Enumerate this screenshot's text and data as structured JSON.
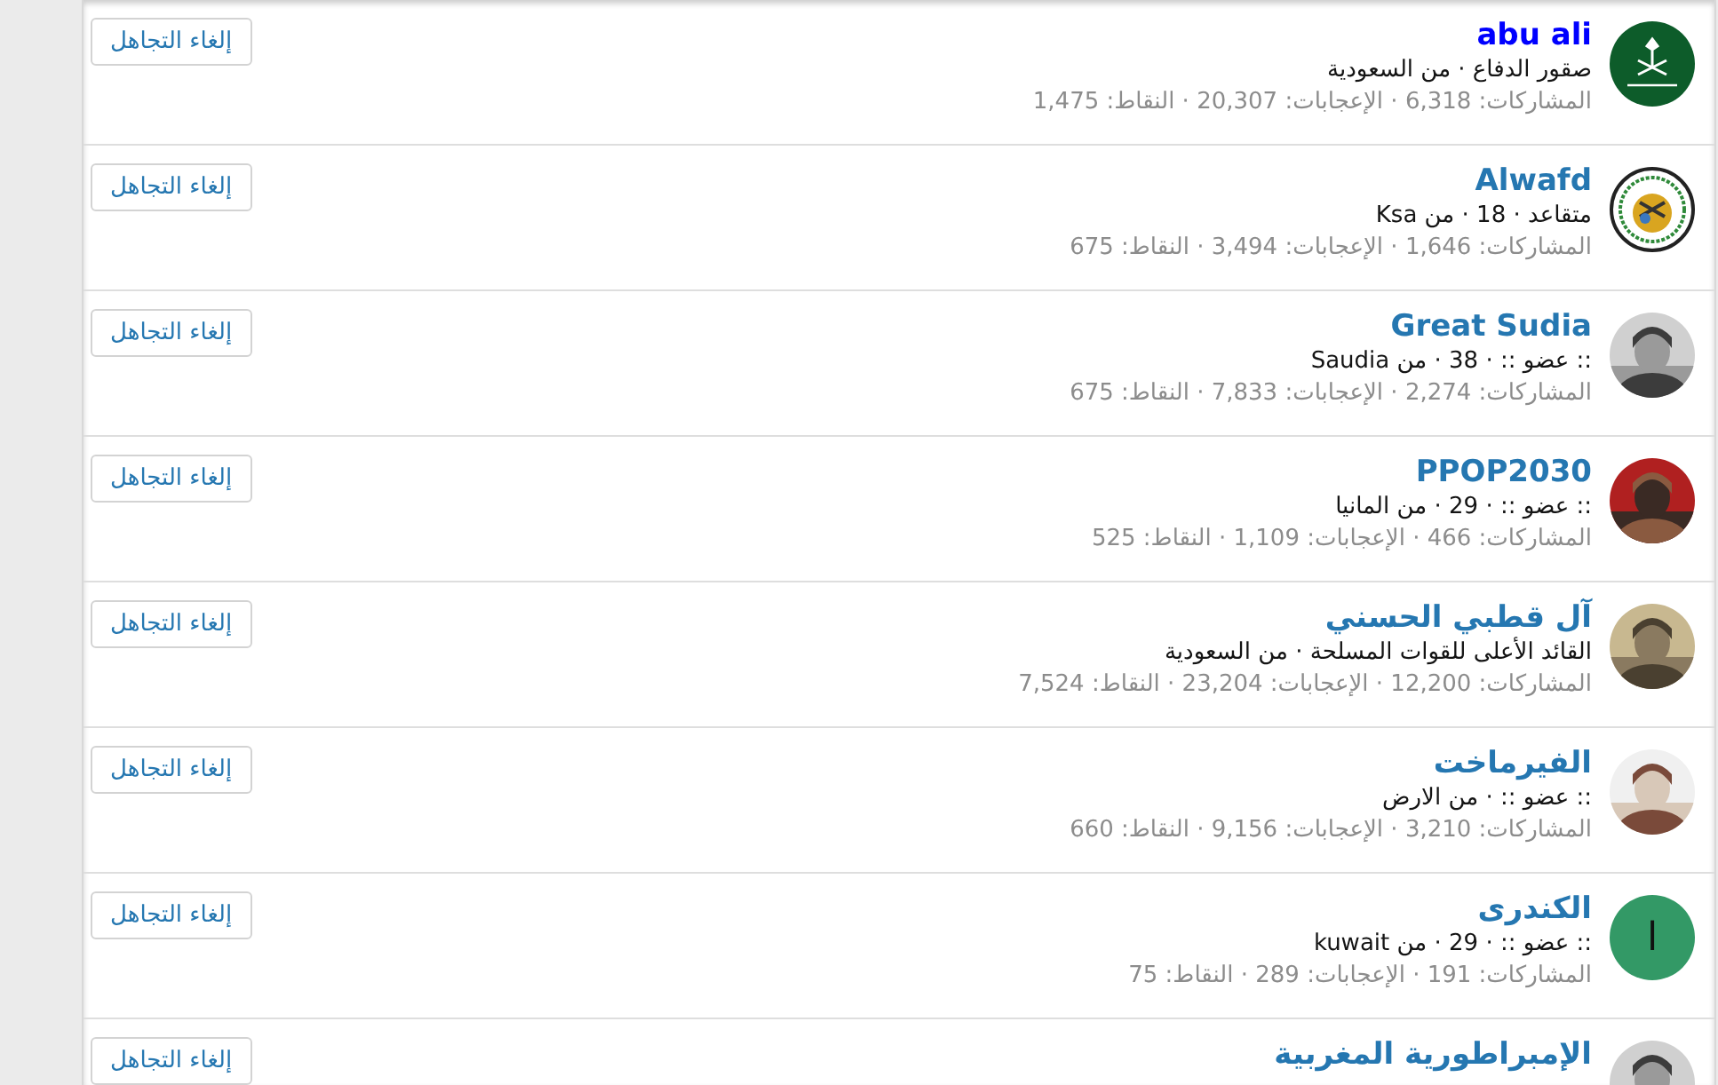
{
  "users": [
    {
      "name": "abu ali",
      "color": "#0000ff",
      "details": "صقور الدفاع · من السعودية",
      "stats": "المشاركات: 6,318 · الإعجابات: 20,307 · النقاط: 1,475",
      "avatar": {
        "kind": "emblem-green"
      },
      "button": "إلغاء التجاهل"
    },
    {
      "name": "Alwafd",
      "color": "#2577b1",
      "details": "متقاعد · 18 · من Ksa",
      "stats": "المشاركات: 1,646 · الإعجابات: 3,494 · النقاط: 675",
      "avatar": {
        "kind": "emblem-seal"
      },
      "button": "إلغاء التجاهل"
    },
    {
      "name": "Great Sudia",
      "color": "#2577b1",
      "details": ":: عضو :: · 38 · من Saudia",
      "stats": "المشاركات: 2,274 · الإعجابات: 7,833 · النقاط: 675",
      "button": "إلغاء التجاهل"
    },
    {
      "name": "PPOP2030",
      "color": "#2577b1",
      "details": ":: عضو :: · 29 · من المانيا",
      "stats": "المشاركات: 466 · الإعجابات: 1,109 · النقاط: 525",
      "button": "إلغاء التجاهل"
    },
    {
      "name": "آل قطبي الحسني",
      "color": "#2577b1",
      "details": "القائد الأعلى للقوات المسلحة · من السعودية",
      "stats": "المشاركات: 12,200 · الإعجابات: 23,204 · النقاط: 7,524",
      "button": "إلغاء التجاهل"
    },
    {
      "name": "الفيرماخت",
      "color": "#2577b1",
      "details": ":: عضو :: · من الارض",
      "stats": "المشاركات: 3,210 · الإعجابات: 9,156 · النقاط: 660",
      "button": "إلغاء التجاهل"
    },
    {
      "name": "الكندرى",
      "color": "#2577b1",
      "details": ":: عضو :: · 29 · من kuwait",
      "stats": "المشاركات: 191 · الإعجابات: 289 · النقاط: 75",
      "avatar": {
        "kind": "letter",
        "letter": "ا",
        "color": "#339966"
      },
      "button": "إلغاء التجاهل"
    },
    {
      "name": "الإمبراطورية المغربية",
      "color": "#2577b1",
      "button": "إلغاء التجاهل"
    }
  ]
}
